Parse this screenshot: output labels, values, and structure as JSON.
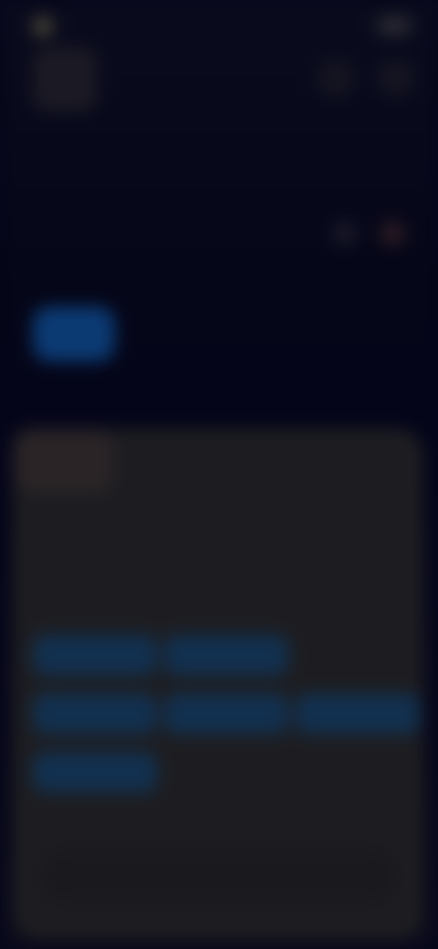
{
  "status_bar": {
    "time": "",
    "battery": ""
  },
  "header": {
    "app_title": ""
  },
  "section": {
    "label": "",
    "subtext": ""
  },
  "card": {
    "top_text": "",
    "small_text": "",
    "heading": "",
    "subheading": "",
    "chips": [
      "",
      "",
      "",
      "",
      "",
      ""
    ],
    "bottom_bar_text": ""
  },
  "colors": {
    "background": "#05061a",
    "card": "#1d1d21",
    "chip_bg": "#12304f",
    "chip_text": "#4f86c6",
    "accent_blue": "#0b3a73"
  }
}
